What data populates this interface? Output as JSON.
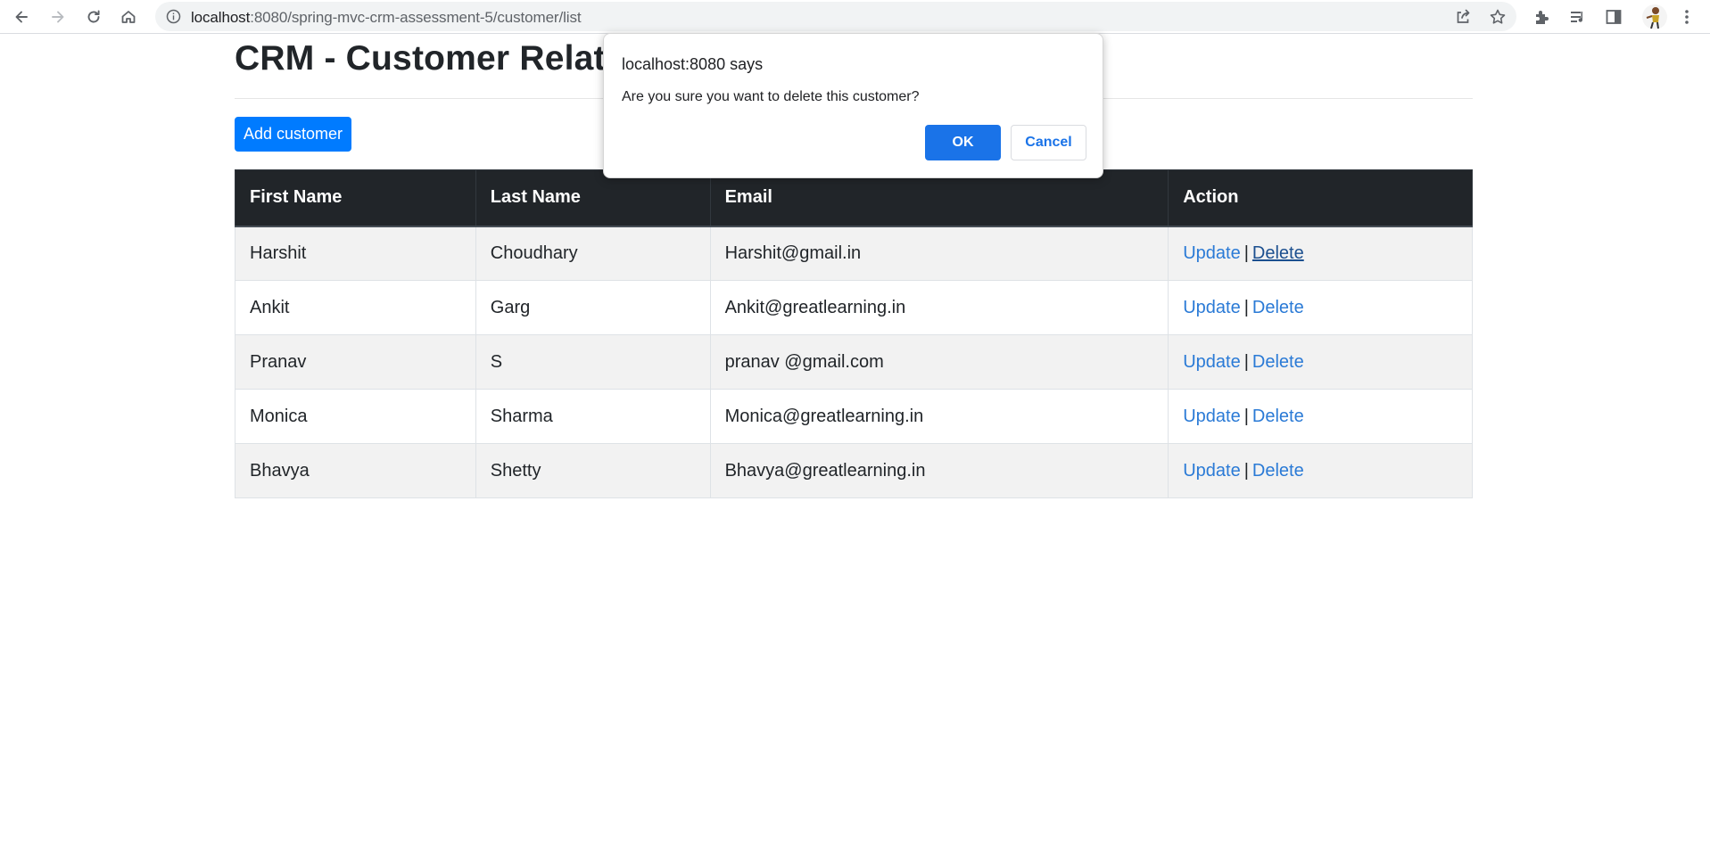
{
  "browser": {
    "url_host": "localhost",
    "url_rest": ":8080/spring-mvc-crm-assessment-5/customer/list",
    "icons": [
      "back-icon",
      "forward-icon",
      "reload-icon",
      "home-icon",
      "info-icon",
      "share-icon",
      "bookmark-star-icon",
      "extensions-icon",
      "media-queue-icon",
      "side-panel-icon",
      "profile-avatar",
      "menu-dots-icon"
    ]
  },
  "page": {
    "title": "CRM - Customer Relationship Manager",
    "add_button": "Add customer"
  },
  "table": {
    "headers": [
      "First Name",
      "Last Name",
      "Email",
      "Action"
    ],
    "rows": [
      {
        "first": "Harshit",
        "last": "Choudhary",
        "email": "Harshit@gmail.in",
        "update": "Update",
        "sep": "|",
        "delete": "Delete"
      },
      {
        "first": "Ankit",
        "last": "Garg",
        "email": "Ankit@greatlearning.in",
        "update": "Update",
        "sep": "|",
        "delete": "Delete"
      },
      {
        "first": "Pranav",
        "last": "S",
        "email": "pranav @gmail.com",
        "update": "Update",
        "sep": "|",
        "delete": "Delete"
      },
      {
        "first": "Monica",
        "last": "Sharma",
        "email": "Monica@greatlearning.in",
        "update": "Update",
        "sep": "|",
        "delete": "Delete"
      },
      {
        "first": "Bhavya",
        "last": "Shetty",
        "email": "Bhavya@greatlearning.in",
        "update": "Update",
        "sep": "|",
        "delete": "Delete"
      }
    ]
  },
  "dialog": {
    "title": "localhost:8080 says",
    "message": "Are you sure you want to delete this customer?",
    "ok": "OK",
    "cancel": "Cancel"
  },
  "colors": {
    "primary_button": "#007bff",
    "table_header": "#212529",
    "link": "#2a7ad6",
    "dialog_ok": "#1a73e8"
  }
}
